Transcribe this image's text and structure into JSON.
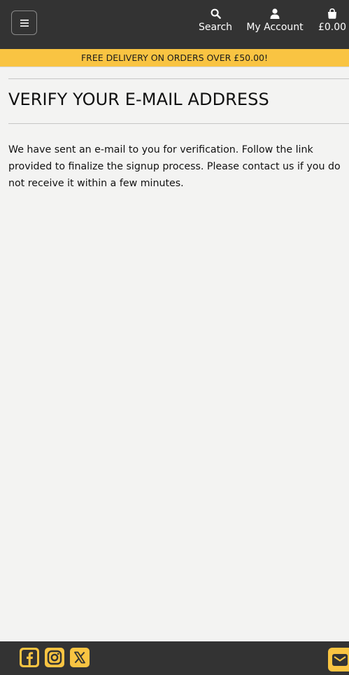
{
  "header": {
    "search_label": "Search",
    "account_label": "My Account",
    "basket_total": "£0.00"
  },
  "banner": {
    "text": "FREE DELIVERY ON ORDERS OVER £50.00!"
  },
  "main": {
    "title": "VERIFY YOUR E-MAIL ADDRESS",
    "message": "We have sent an e-mail to you for verification. Follow the link provided to finalize the signup process. Please contact us if you do not receive it within a few minutes."
  },
  "colors": {
    "header_bg": "#333333",
    "banner_bg": "#f9c442",
    "page_bg": "#f3f3f2"
  },
  "icons": {
    "menu": "hamburger-icon",
    "search": "search-icon",
    "account": "user-icon",
    "basket": "shopping-bag-icon",
    "facebook": "facebook-icon",
    "instagram": "instagram-icon",
    "x": "x-twitter-icon",
    "mail": "envelope-icon"
  }
}
